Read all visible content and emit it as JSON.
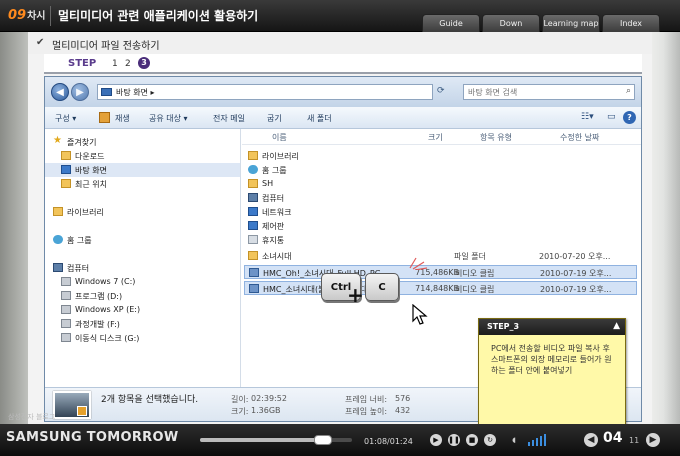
{
  "header": {
    "chapter_num": "09",
    "chapter_suffix": "차시",
    "title": "멀티미디어 관련 애플리케이션 활용하기",
    "nav": [
      "Guide",
      "Down",
      "Learning map",
      "Index"
    ]
  },
  "lesson": {
    "title": "멀티미디어 파일 전송하기",
    "step_label": "STEP",
    "steps": [
      "1",
      "2",
      "3"
    ],
    "active_step": "3"
  },
  "explorer": {
    "address": "바탕 화면  ▸",
    "search_placeholder": "바탕 화면 검색",
    "commands": [
      "구성 ▾",
      "재생",
      "공유 대상 ▾",
      "전자 메일",
      "굽기",
      "새 폴더"
    ],
    "nav_pane": [
      {
        "label": "즐겨찾기",
        "icon": "star-icon"
      },
      {
        "label": "다운로드",
        "icon": "folder-icon"
      },
      {
        "label": "바탕 화면",
        "icon": "desktop-icon"
      },
      {
        "label": "최근 위치",
        "icon": "folder-icon"
      },
      {
        "label": "라이브러리",
        "icon": "library-icon"
      },
      {
        "label": "홈 그룹",
        "icon": "homegroup-icon"
      },
      {
        "label": "컴퓨터",
        "icon": "computer-icon"
      },
      {
        "label": "Windows 7 (C:)",
        "icon": "drive-icon"
      },
      {
        "label": "프로그램 (D:)",
        "icon": "drive-icon"
      },
      {
        "label": "Windows XP (E:)",
        "icon": "drive-icon"
      },
      {
        "label": "과정개발 (F:)",
        "icon": "drive-icon"
      },
      {
        "label": "이동식 디스크 (G:)",
        "icon": "drive-icon"
      }
    ],
    "columns": [
      "이름",
      "크기",
      "항목 유형",
      "수정한 날짜"
    ],
    "files": [
      {
        "name": "라이브러리",
        "size": "",
        "type": "",
        "date": "",
        "icon": "library-icon",
        "selected": false
      },
      {
        "name": "홈 그룹",
        "size": "",
        "type": "",
        "date": "",
        "icon": "homegroup-icon",
        "selected": false
      },
      {
        "name": "SH",
        "size": "",
        "type": "",
        "date": "",
        "icon": "user-folder-icon",
        "selected": false
      },
      {
        "name": "컴퓨터",
        "size": "",
        "type": "",
        "date": "",
        "icon": "computer-icon",
        "selected": false
      },
      {
        "name": "네트워크",
        "size": "",
        "type": "",
        "date": "",
        "icon": "network-icon",
        "selected": false
      },
      {
        "name": "제어판",
        "size": "",
        "type": "",
        "date": "",
        "icon": "control-panel-icon",
        "selected": false
      },
      {
        "name": "휴지통",
        "size": "",
        "type": "",
        "date": "",
        "icon": "trash-icon",
        "selected": false
      },
      {
        "name": "소녀시대",
        "size": "",
        "type": "파일 폴더",
        "date": "2010-07-20 오후...",
        "icon": "folder-icon",
        "selected": false
      },
      {
        "name": "HMC_Oh!_소녀시대_Full HD_PC",
        "size": "715,486KB",
        "type": "비디오 클립",
        "date": "2010-07-19 오후...",
        "icon": "video-icon",
        "selected": true
      },
      {
        "name": "HMC_소녀시대(블랙소시) 현대벨...",
        "size": "714,848KB",
        "type": "비디오 클립",
        "date": "2010-07-19 오후...",
        "icon": "video-icon",
        "selected": true
      }
    ],
    "keys": {
      "ctrl": "Ctrl",
      "plus": "+",
      "c": "C"
    },
    "details": {
      "count": "2개 항목을 선택했습니다.",
      "length_label": "길이:",
      "length": "02:39:52",
      "size_label": "크기:",
      "size": "1.36GB",
      "width_label": "프레임 너비:",
      "width": "576",
      "height_label": "프레임 높이:",
      "height": "432"
    }
  },
  "popup": {
    "title": "STEP_3",
    "text": "PC에서 전송할 비디오 파일 복사 후 스마트폰의 외장 메모리로 들어가 원하는 폴더 안에 붙여넣기"
  },
  "player": {
    "brand_sub": "삼성전자 블로그",
    "brand": "SAMSUNG TOMORROW",
    "time": "01:08/01:24",
    "progress": 0.81,
    "page": "04",
    "total": "11"
  },
  "colors": {
    "accent_orange": "#ff8a1e",
    "step_purple": "#4a2d7a",
    "popup_yellow": "#fff9a8",
    "selection_blue": "#d3e2f6"
  }
}
